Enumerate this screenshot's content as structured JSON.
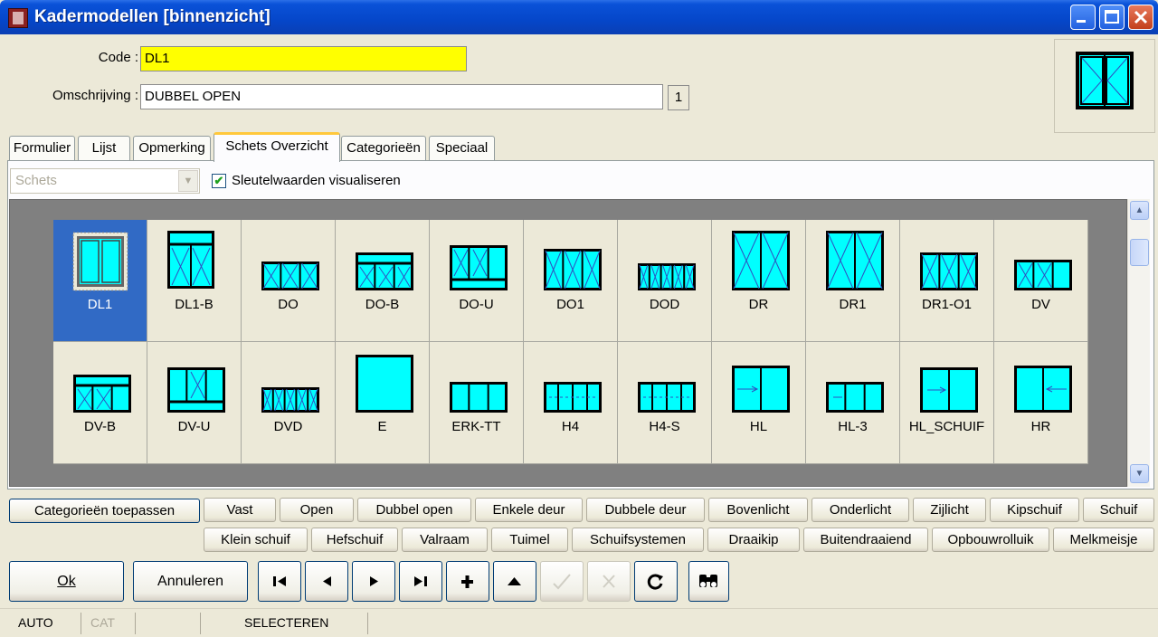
{
  "window": {
    "title": "Kadermodellen [binnenzicht]",
    "min_label": "_",
    "max_label": "□",
    "close_label": "X"
  },
  "header": {
    "code_label": "Code :",
    "code_value": "DL1",
    "desc_label": "Omschrijving :",
    "desc_value": "DUBBEL OPEN",
    "count": "1"
  },
  "tabs": [
    {
      "label": "Formulier"
    },
    {
      "label": "Lijst"
    },
    {
      "label": "Opmerking"
    },
    {
      "label": "Schets Overzicht",
      "active": true
    },
    {
      "label": "Categorieën"
    },
    {
      "label": "Speciaal"
    }
  ],
  "toolbar": {
    "combo_placeholder": "Schets",
    "checkbox_checked": true,
    "checkbox_label": "Sleutelwaarden visualiseren"
  },
  "sketches": [
    {
      "code": "DL1",
      "selected": true
    },
    {
      "code": "DL1-B"
    },
    {
      "code": "DO"
    },
    {
      "code": "DO-B"
    },
    {
      "code": "DO-U"
    },
    {
      "code": "DO1"
    },
    {
      "code": "DOD"
    },
    {
      "code": "DR"
    },
    {
      "code": "DR1"
    },
    {
      "code": "DR1-O1"
    },
    {
      "code": "DV"
    },
    {
      "code": "DV-B"
    },
    {
      "code": "DV-U"
    },
    {
      "code": "DVD"
    },
    {
      "code": "E"
    },
    {
      "code": "ERK-TT"
    },
    {
      "code": "H4"
    },
    {
      "code": "H4-S"
    },
    {
      "code": "HL"
    },
    {
      "code": "HL-3"
    },
    {
      "code": "HL_SCHUIF"
    },
    {
      "code": "HR"
    }
  ],
  "categories_row1": [
    "Categorieën toepassen",
    "Vast",
    "Open",
    "Dubbel open",
    "Enkele deur",
    "Dubbele deur",
    "Bovenlicht",
    "Onderlicht",
    "Zijlicht",
    "Kipschuif",
    "Schuif"
  ],
  "categories_row2": [
    "Klein schuif",
    "Hefschuif",
    "Valraam",
    "Tuimel",
    "Schuifsystemen",
    "Draaikip",
    "Buitendraaiend",
    "Opbouwrolluik",
    "Melkmeisje"
  ],
  "actions": {
    "ok": "Ok",
    "cancel": "Annuleren"
  },
  "nav_icons": [
    "first-icon",
    "previous-icon",
    "next-icon",
    "last-icon",
    "add-icon",
    "up-icon",
    "confirm-icon",
    "cancel-icon",
    "refresh-icon",
    "binoculars-icon"
  ],
  "status": {
    "mode": "AUTO",
    "cat": "CAT",
    "action": "SELECTEREN"
  },
  "colors": {
    "glass": "#00ffff",
    "selection": "#316ac5",
    "code_field": "#ffff00"
  }
}
